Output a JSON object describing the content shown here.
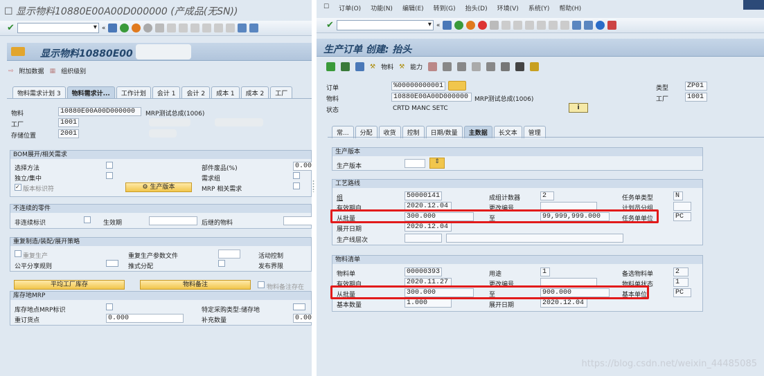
{
  "left": {
    "title": "显示物料10880E00A00D000000 (产成品(无SN))",
    "header_title": "显示物料10880E00",
    "header_title_tail": "...",
    "app_buttons": [
      "附加数据",
      "组织级别"
    ],
    "tabs": [
      "物料需求计划 3",
      "物料需求计...",
      "工作计划",
      "会计 1",
      "会计 2",
      "成本 1",
      "成本 2",
      "工厂"
    ],
    "material_label": "物料",
    "material_value": "10880E00A00D000000",
    "material_desc": "MRP测试总成(1006)",
    "plant_label": "工厂",
    "plant_value": "1001",
    "storage_label": "存储位置",
    "storage_value": "2001",
    "bom_group": {
      "title": "BOM展开/相关需求",
      "select_method": "选择方法",
      "component_scrap": "部件废品(%)",
      "component_scrap_value": "0.00",
      "indiv_coll": "独立/集中",
      "req_group": "需求组",
      "version_indicator": "版本标识符",
      "prod_version_btn": "生产版本",
      "mrp_dep_req": "MRP 相关需求"
    },
    "disc_group": {
      "title": "不连续的零件",
      "disc_ind": "非连续标识",
      "eff_out": "生效期",
      "follow_up": "后继的物料"
    },
    "rep_group": {
      "title": "重复制造/装配/展开策略",
      "rep_mfg": "重复生产",
      "rep_profile": "重复生产参数文件",
      "action_control": "活动控制",
      "split_rule": "公平分享规则",
      "push_dist": "推式分配",
      "deploy_horizon": "发布界限"
    },
    "avg_plant_stock_btn": "平均工厂库存",
    "material_memo_btn": "物料备注",
    "material_memo_chk": "物料备注存在",
    "stor_group": {
      "title": "库存地MRP",
      "sloc_mrp": "库存地点MRP标识",
      "spec_proc": "特定采购类型:储存地",
      "reorder_point": "重订货点",
      "reorder_value": "0.000",
      "replen_qty": "补充数量",
      "replen_value": "0.00"
    }
  },
  "right": {
    "menu": [
      "订单(O)",
      "功能(N)",
      "编辑(E)",
      "转到(G)",
      "抬头(D)",
      "环境(V)",
      "系统(Y)",
      "帮助(H)"
    ],
    "header_title": "生产订单 创建: 抬头",
    "app_buttons": [
      "物料",
      "能力"
    ],
    "order_label": "订单",
    "order_value": "%00000000001",
    "type_label": "类型",
    "type_value": "ZP01",
    "material_label": "物料",
    "material_value": "10880E00A00D000000",
    "material_desc": "MRP测试总成(1006)",
    "plant_label": "工厂",
    "plant_value": "1001",
    "status_label": "状态",
    "status_value": "CRTD MANC SETC",
    "tabs": [
      "常...",
      "分配",
      "收货",
      "控制",
      "日期/数量",
      "主数据",
      "长文本",
      "管理"
    ],
    "prod_version_group": {
      "title": "生产版本",
      "label": "生产版本"
    },
    "routing_group": {
      "title": "工艺路线",
      "group_label": "组",
      "group_value": "50000141",
      "counter_label": "成组计数器",
      "counter_value": "2",
      "list_type_label": "任务单类型",
      "list_type_value": "N",
      "valid_from_label": "有效期自",
      "valid_from_value": "2020.12.04",
      "change_no_label": "更改编号",
      "planner_grp_label": "计划员分组",
      "from_lot_label": "从批量",
      "from_lot_value": "300.000",
      "to_label": "至",
      "to_value": "99,999,999.000",
      "unit_label": "任务单单位",
      "unit_value": "PC",
      "explode_date_label": "展开日期",
      "explode_date_value": "2020.12.04",
      "line_hier_label": "生产线层次"
    },
    "bom_group": {
      "title": "物料清单",
      "bom_label": "物料单",
      "bom_value": "00000393",
      "usage_label": "用途",
      "usage_value": "1",
      "alt_bom_label": "备选物料单",
      "alt_bom_value": "2",
      "valid_from_label": "有效期自",
      "valid_from_value": "2020.11.27",
      "change_no_label": "更改编号",
      "bom_status_label": "物料单状态",
      "bom_status_value": "1",
      "from_lot_label": "从批量",
      "from_lot_value": "300.000",
      "to_label": "至",
      "to_value": "900.000",
      "base_unit_label": "基本单位",
      "base_unit_value": "PC",
      "base_qty_label": "基本数量",
      "base_qty_value": "1.000",
      "explode_date_label": "展开日期",
      "explode_date_value": "2020.12.04"
    }
  },
  "watermark": "https://blog.csdn.net/weixin_44485085",
  "colors": {
    "highlight": "#e21a1a",
    "header_text": "#24476d",
    "button": "#f1c64c"
  }
}
